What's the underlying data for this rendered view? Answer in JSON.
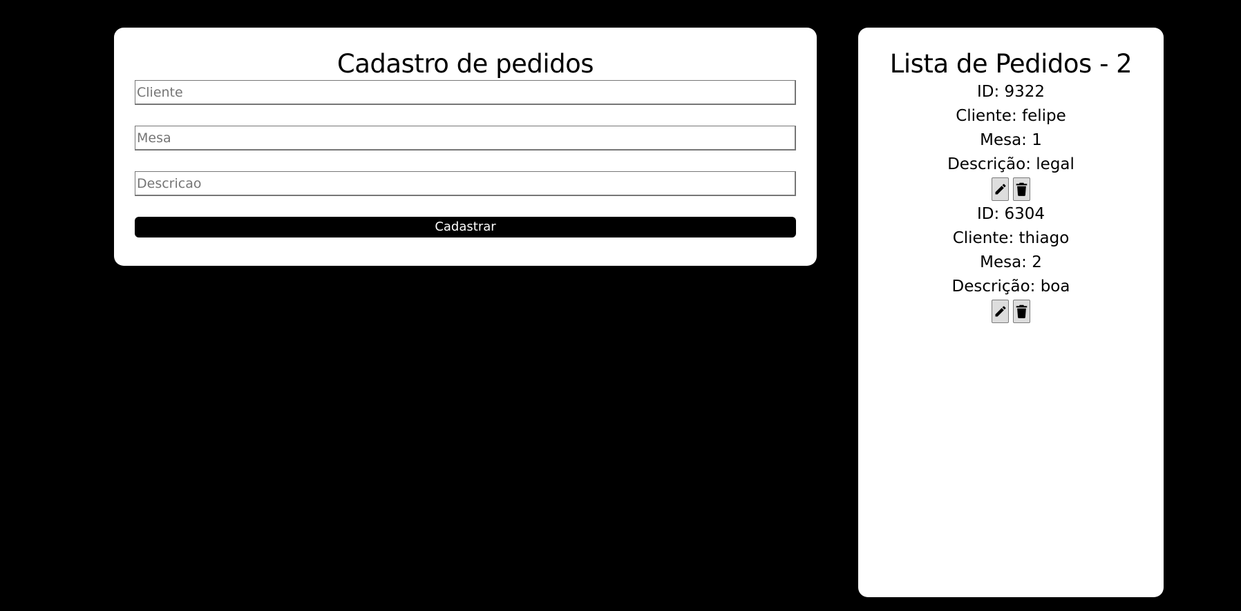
{
  "form": {
    "title": "Cadastro de pedidos",
    "fields": {
      "cliente_placeholder": "Cliente",
      "cliente_value": "",
      "mesa_placeholder": "Mesa",
      "mesa_value": "",
      "descricao_placeholder": "Descricao",
      "descricao_value": ""
    },
    "submit_label": "Cadastrar"
  },
  "list": {
    "title": "Lista de Pedidos - 2",
    "orders": [
      {
        "id": "ID: 9322",
        "cliente": "Cliente: felipe",
        "mesa": "Mesa: 1",
        "descricao": "Descrição: legal",
        "edit_icon": "pencil-icon",
        "delete_icon": "trash-icon"
      },
      {
        "id": "ID: 6304",
        "cliente": "Cliente: thiago",
        "mesa": "Mesa: 2",
        "descricao": "Descrição: boa",
        "edit_icon": "pencil-icon",
        "delete_icon": "trash-icon"
      }
    ]
  },
  "colors": {
    "background": "#000000",
    "card": "#ffffff",
    "primary_button": "#000000",
    "icon_button_bg": "#dddddd"
  }
}
